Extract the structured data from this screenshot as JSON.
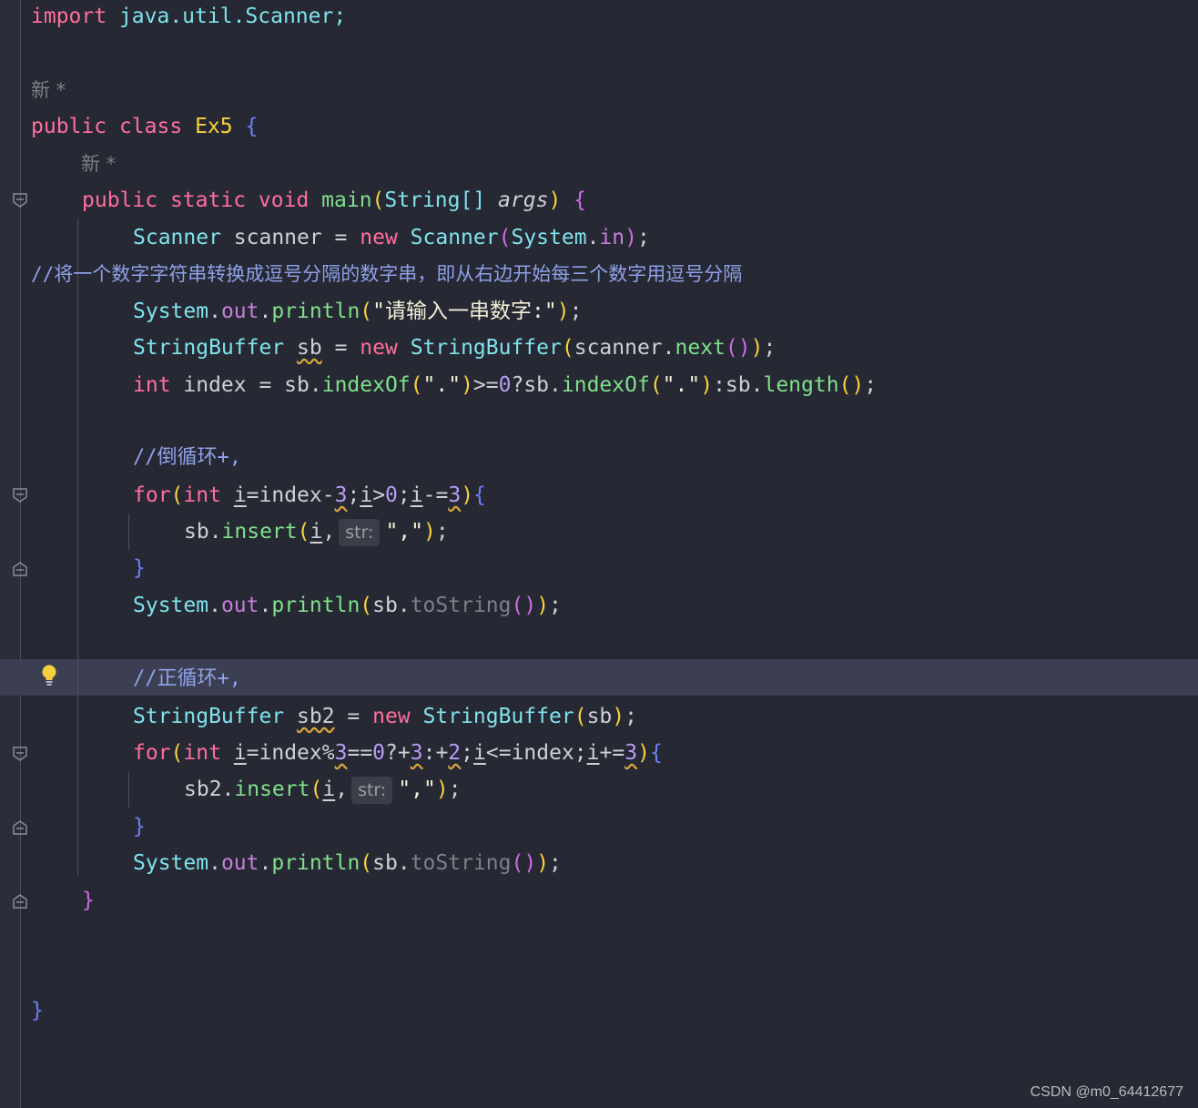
{
  "editor": {
    "lines": {
      "l1": {
        "kw": "import",
        "rest": " java.util.Scanner;"
      },
      "hint1": "新 *",
      "l3": {
        "kw1": "public",
        "kw2": "class",
        "name": "Ex5",
        "brace": "{"
      },
      "hint2": "新 *",
      "l5": {
        "kw1": "public",
        "kw2": "static",
        "kw3": "void",
        "fn": "main",
        "p1": "(",
        "type": "String[]",
        "arg": "args",
        "p2": ")",
        "brace": "{"
      },
      "l6": {
        "t1": "Scanner",
        "v": " scanner = ",
        "kw": "new",
        "t2": "Scanner",
        "p1": "(",
        "t3": "System",
        "dot": ".",
        "fld": "in",
        "p2": ")",
        "end": ";"
      },
      "l7": "//将一个数字字符串转换成逗号分隔的数字串，即从右边开始每三个数字用逗号分隔",
      "l8": {
        "t": "System",
        "d1": ".",
        "fld": "out",
        "d2": ".",
        "fn": "println",
        "p1": "(",
        "s": "\"请输入一串数字:\"",
        "p2": ")",
        "end": ";"
      },
      "l9": {
        "t1": "StringBuffer",
        "sp": " ",
        "v": "sb",
        "eq": " = ",
        "kw": "new",
        "t2": "StringBuffer",
        "p1": "(",
        "obj": "scanner",
        "d": ".",
        "fn": "next",
        "p2": "()",
        "p3": ")",
        "end": ";"
      },
      "l10": {
        "kw": "int",
        "v": " index = sb.",
        "f1": "indexOf",
        "a1": "(",
        "s1": "\".\"",
        "a2": ")",
        ">=": ">=",
        "n": "0",
        "q": "?sb.",
        "f2": "indexOf",
        "b1": "(",
        "s2": "\".\"",
        "b2": ")",
        "c": ":sb.",
        "f3": "length",
        "c1": "()",
        "end": ";"
      },
      "l12": "//倒循环+,",
      "l13": {
        "kw": "for",
        "p1": "(",
        "kw2": "int",
        "sp": " ",
        "i1": "i",
        "a": "=index-",
        "n1": "3",
        "s1": ";",
        "i2": "i",
        "g": ">",
        "n2": "0",
        "s2": ";",
        "i3": "i",
        "m": "-=",
        "n3": "3",
        "p2": ")",
        "brace": "{"
      },
      "l14": {
        "v": "sb.",
        "fn": "insert",
        "p1": "(",
        "i": "i",
        "c": ",",
        "hint": "str:",
        "s": "\",\"",
        "p2": ")",
        "end": ";"
      },
      "close": "}",
      "l16": {
        "t": "System",
        "d1": ".",
        "fld": "out",
        "d2": ".",
        "fn": "println",
        "p1": "(",
        "v": "sb.",
        "dim": "toString",
        "p2": "()",
        "p3": ")",
        "end": ";"
      },
      "l18": "//正循环+,",
      "l19": {
        "t1": "StringBuffer",
        "sp": " ",
        "v": "sb2",
        "eq": " = ",
        "kw": "new",
        "t2": "StringBuffer",
        "p1": "(",
        "a": "sb",
        "p2": ")",
        "end": ";"
      },
      "l20": {
        "kw": "for",
        "p1": "(",
        "kw2": "int",
        "sp": " ",
        "i1": "i",
        "a": "=index%",
        "n1": "3",
        "e": "==",
        "n2": "0",
        "q": "?+",
        "n3": "3",
        "c": ":+",
        "n4": "2",
        "s1": ";",
        "i2": "i",
        "le": "<=index;",
        "i3": "i",
        "pe": "+=",
        "n5": "3",
        "p2": ")",
        "brace": "{"
      },
      "l21": {
        "v": "sb2.",
        "fn": "insert",
        "p1": "(",
        "i": "i",
        "c": ",",
        "hint": "str:",
        "s": "\",\"",
        "p2": ")",
        "end": ";"
      },
      "l23": {
        "t": "System",
        "d1": ".",
        "fld": "out",
        "d2": ".",
        "fn": "println",
        "p1": "(",
        "v": "sb.",
        "dim": "toString",
        "p2": "()",
        "p3": ")",
        "end": ";"
      }
    }
  },
  "watermark": "CSDN @m0_64412677",
  "icons": {
    "fold": "fold-marker-icon",
    "bulb": "lightbulb-icon"
  }
}
